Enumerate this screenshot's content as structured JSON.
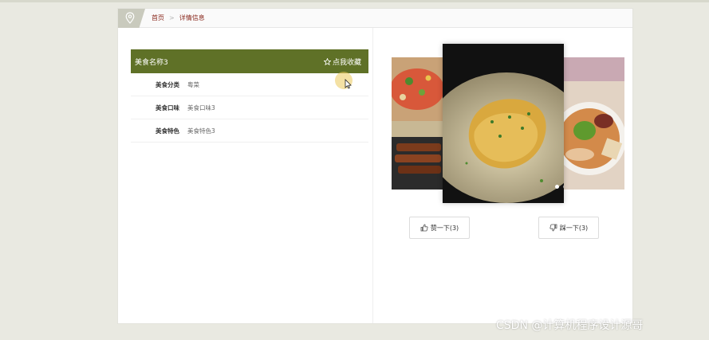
{
  "breadcrumb": {
    "home": "首页",
    "separator": ">",
    "current": "详情信息"
  },
  "food": {
    "title": "美食名称3",
    "favorite_label": "点我收藏",
    "fields": [
      {
        "label": "美食分类",
        "value": "粤菜"
      },
      {
        "label": "美食口味",
        "value": "美食口味3"
      },
      {
        "label": "美食特色",
        "value": "美食特色3"
      }
    ]
  },
  "carousel": {
    "dots": 3,
    "active_index": 0
  },
  "actions": {
    "like_label": "赞一下(3)",
    "dislike_label": "踩一下(3)"
  },
  "watermark": "CSDN @计算机程序设计源哥",
  "colors": {
    "accent": "#5f7127",
    "crumb_link": "#8a2a1e",
    "background": "#e9e9e1"
  },
  "icons": {
    "breadcrumb": "location-pin-icon",
    "favorite": "star-outline-icon",
    "like": "thumbs-up-icon",
    "dislike": "thumbs-down-icon"
  }
}
